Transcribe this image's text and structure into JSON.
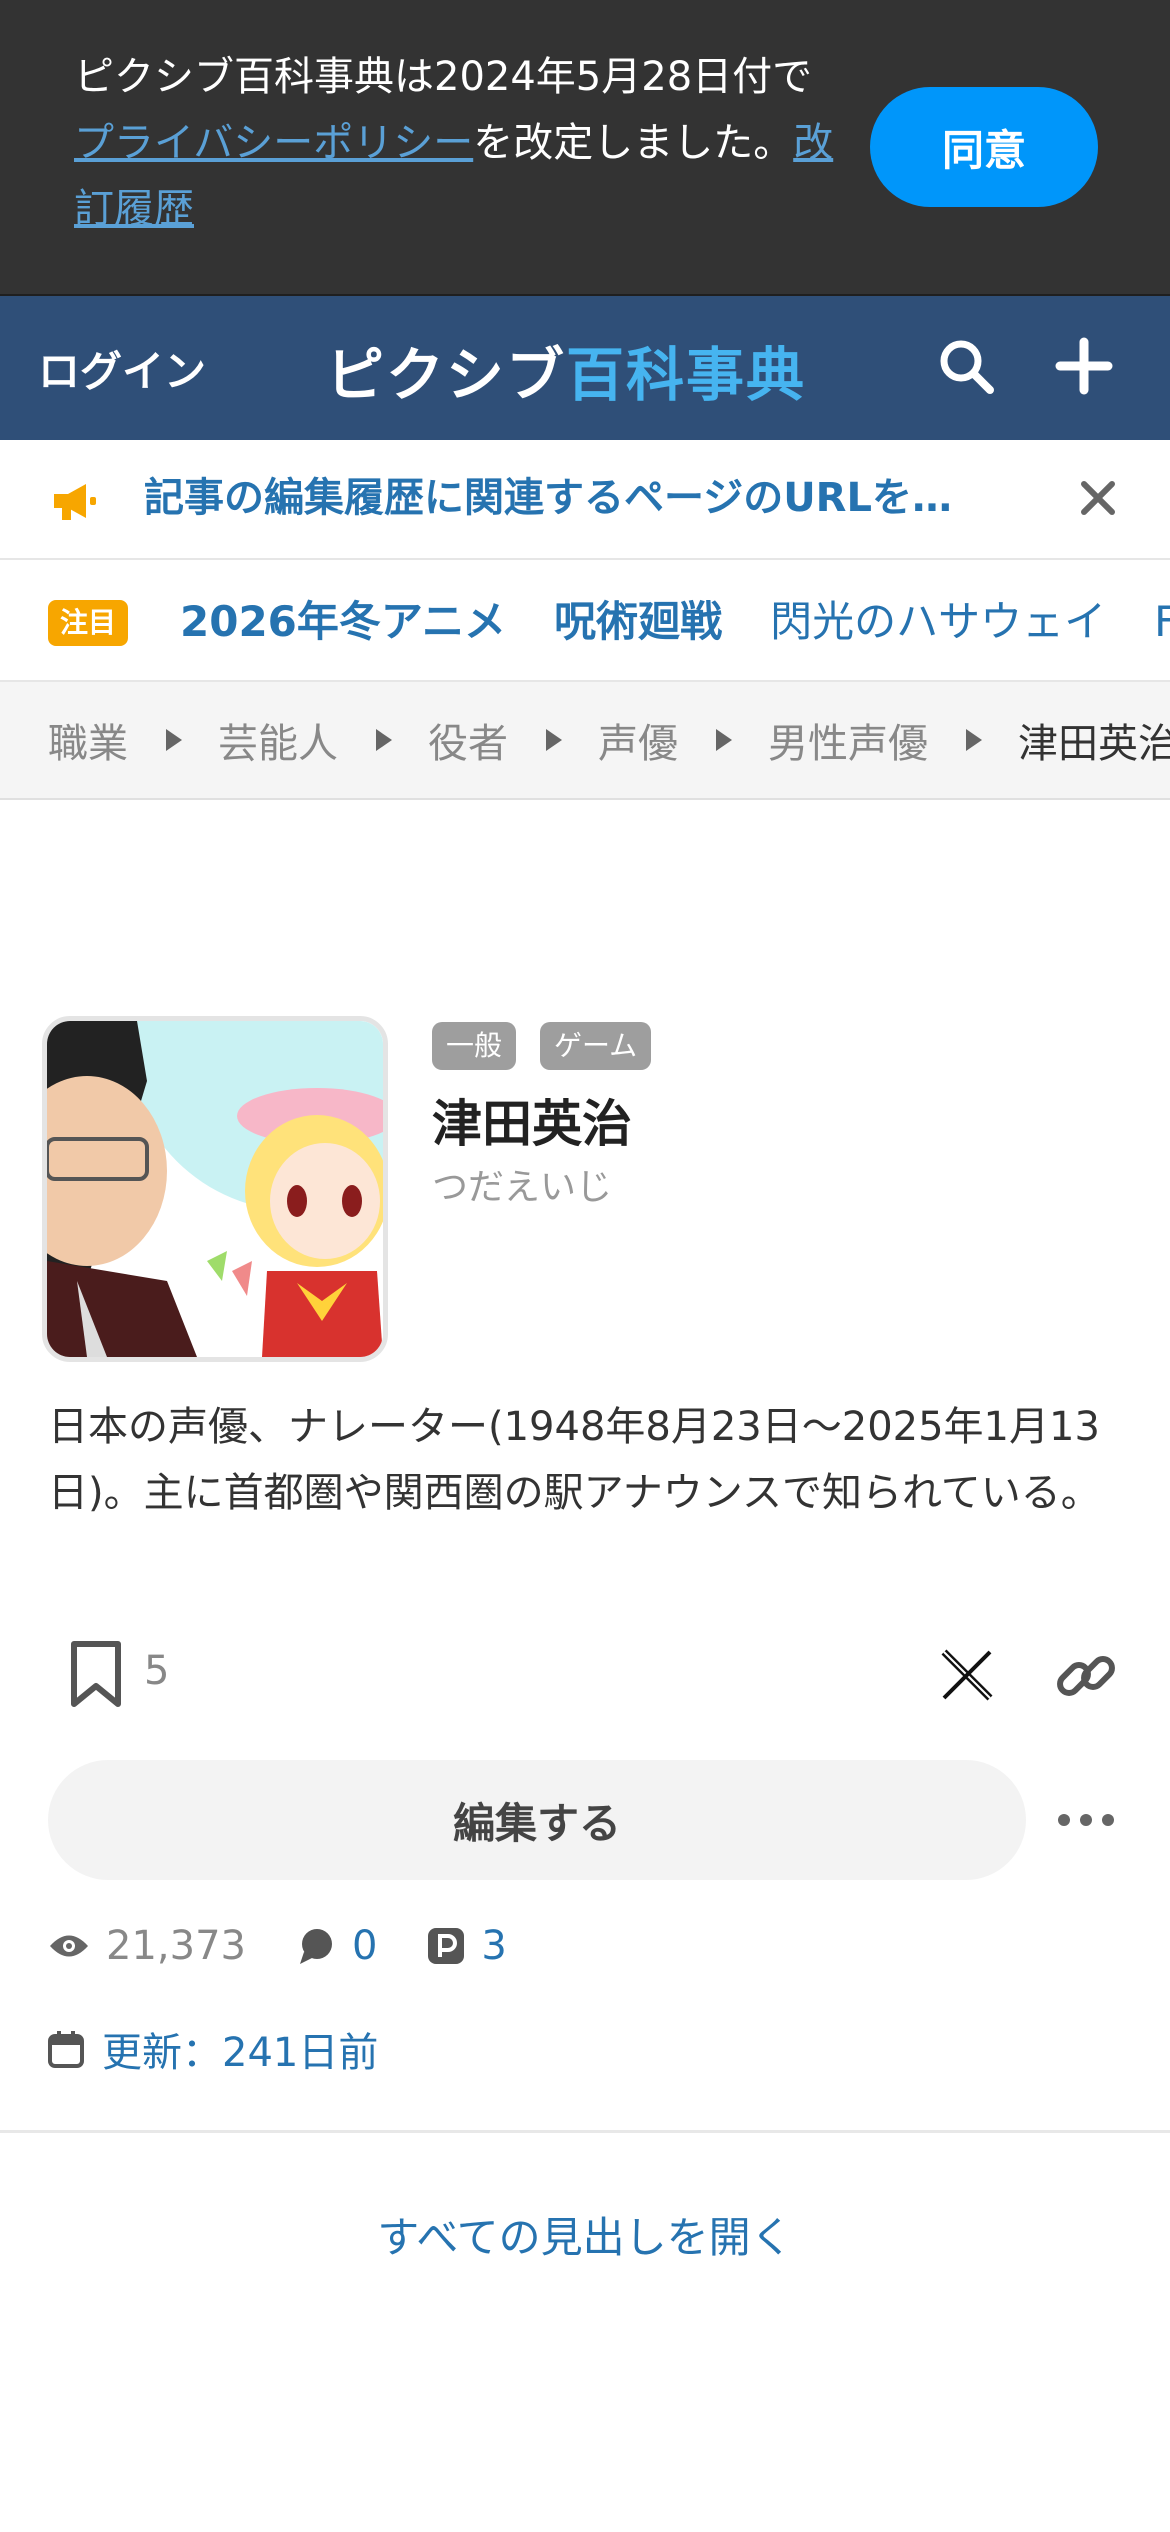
{
  "banner": {
    "text_before": "ピクシブ百科事典は2024年5月28日付で",
    "privacy_link": "プライバシーポリシー",
    "text_middle": "を改定しました。",
    "history_link": "改訂履歴",
    "agree_label": "同意"
  },
  "header": {
    "login_label": "ログイン",
    "logo_part1": "ピクシブ",
    "logo_part2": "百科事典"
  },
  "notice": {
    "text": "記事の編集履歴に関連するページのURLを…"
  },
  "trending": {
    "badge": "注目",
    "items": [
      "2026年冬アニメ",
      "呪術廻戦",
      "閃光のハサウェイ",
      "F"
    ]
  },
  "breadcrumb": [
    "職業",
    "芸能人",
    "役者",
    "声優",
    "男性声優",
    "津田英治"
  ],
  "article": {
    "tags": [
      "一般",
      "ゲーム"
    ],
    "title": "津田英治",
    "reading": "つだえいじ",
    "summary": "日本の声優、ナレーター(1948年8月23日〜2025年1月13日)。主に首都圏や関西圏の駅アナウンスで知られている。",
    "bookmark_count": "5",
    "edit_label": "編集する",
    "views": "21,373",
    "comments": "0",
    "pixiv_works": "3",
    "updated": "更新：241日前",
    "open_all_label": "すべての見出しを開く"
  },
  "colors": {
    "header_bg": "#2f4f78",
    "accent_blue": "#2673b0",
    "agree_button": "#0096fa",
    "badge_orange": "#f7a600"
  }
}
